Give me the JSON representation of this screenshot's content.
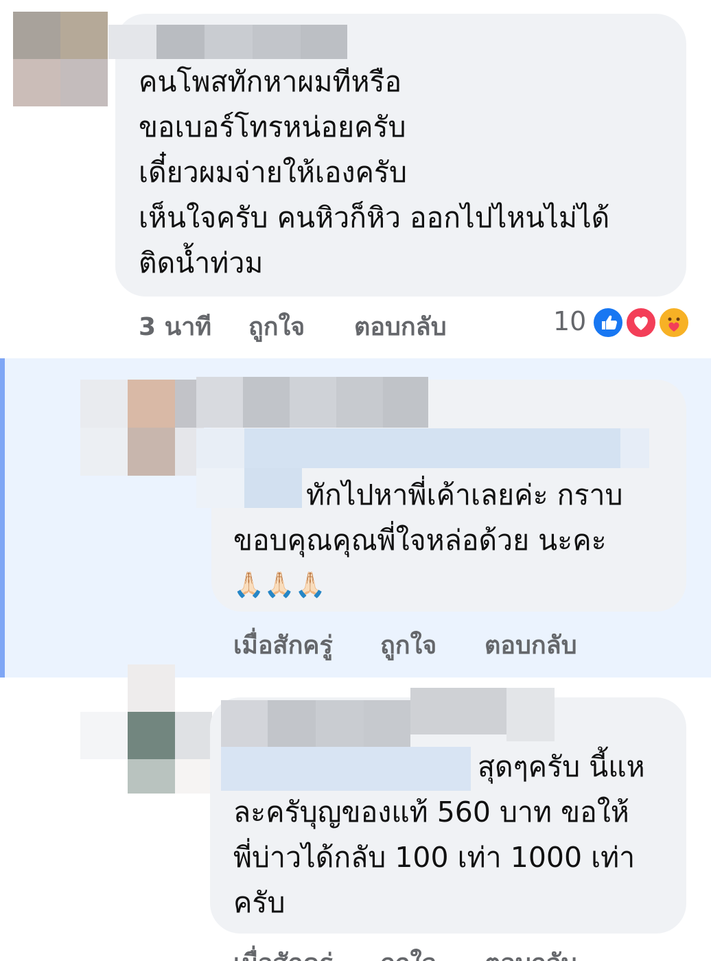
{
  "comments": [
    {
      "lines": [
        "คนโพสทักหาผมทีหรือ",
        "ขอเบอร์โทรหน่อยครับ",
        "เดี๋ยวผมจ่ายให้เองครับ",
        "เห็นใจครับ คนหิวก็หิว ออกไปไหนไม่ได้",
        "ติดน้ำท่วม"
      ],
      "time": "3 นาที",
      "like_label": "ถูกใจ",
      "reply_label": "ตอบกลับ",
      "reaction_count": "10",
      "reactions": [
        "like-reaction-icon",
        "love-reaction-icon",
        "care-reaction-icon"
      ]
    },
    {
      "lines": [
        "ทักไปหาพี่เค้าเลยค่ะ กราบ",
        "ขอบคุณคุณพี่ใจหล่อด้วย นะคะ",
        "🙏🏻🙏🏻🙏🏻"
      ],
      "time": "เมื่อสักครู่",
      "like_label": "ถูกใจ",
      "reply_label": "ตอบกลับ"
    },
    {
      "lines": [
        "สุดๆครับ นี้แห",
        "ละครับุญของแท้ 560 บาท ขอให้",
        "พี่บ่าวได้กลับ 100 เท่า 1000 เท่า",
        "ครับ"
      ],
      "time": "เมื่อสักครู่",
      "like_label": "ถูกใจ",
      "reply_label": "ตอบกลับ"
    }
  ],
  "colors": {
    "bubble": "#f0f2f5",
    "reply_highlight": "#ebf3fe",
    "thread_bar": "#7fa6f5",
    "meta_text": "#65676b",
    "like": "#1877f2",
    "love": "#f33e58",
    "care": "#f7b125"
  }
}
